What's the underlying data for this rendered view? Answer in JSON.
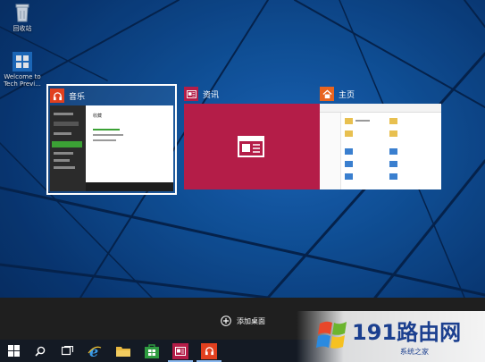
{
  "desktop": {
    "icons": [
      {
        "label": "回收站",
        "icon": "recycle-bin-icon"
      },
      {
        "label": "Welcome to Tech Previ...",
        "icon": "windows-logo-icon"
      }
    ]
  },
  "taskview": {
    "windows": [
      {
        "title": "音乐",
        "app_icon": "headphones-icon",
        "accent": "#e1401f",
        "selected": true
      },
      {
        "title": "资讯",
        "app_icon": "news-icon",
        "accent": "#b41d48",
        "selected": false
      },
      {
        "title": "主页",
        "app_icon": "house-icon",
        "accent": "#e8641f",
        "selected": false
      }
    ],
    "music_preview": {
      "sidebar_items": [
        "",
        "",
        "",
        "",
        "",
        ""
      ],
      "heading": "收藏"
    }
  },
  "desktops_bar": {
    "add_desktop_label": "添加桌面"
  },
  "taskbar": {
    "buttons": [
      {
        "icon": "start-windows-icon"
      },
      {
        "icon": "search-icon"
      },
      {
        "icon": "task-view-icon"
      },
      {
        "icon": "internet-explorer-icon"
      },
      {
        "icon": "file-explorer-icon"
      },
      {
        "icon": "store-icon"
      },
      {
        "icon": "news-app-icon"
      },
      {
        "icon": "music-app-icon"
      }
    ]
  },
  "watermark": {
    "text": "191路由网",
    "sub": "系统之家"
  },
  "colors": {
    "news_red": "#b41d48",
    "music_orange": "#e1401f",
    "desktops_bar": "#1f1f1f",
    "taskbar": "#141a24"
  }
}
